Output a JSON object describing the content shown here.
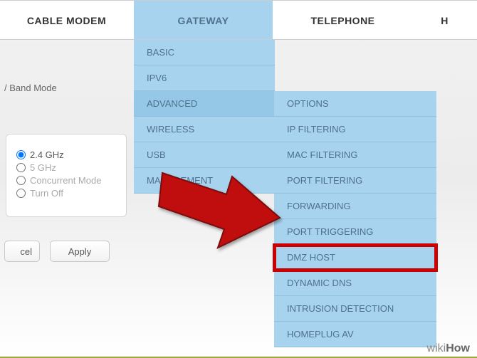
{
  "nav": {
    "tabs": [
      "CABLE MODEM",
      "GATEWAY",
      "TELEPHONE",
      "H"
    ],
    "active_index": 1
  },
  "breadcrumb": "/ Band Mode",
  "menu1": {
    "items": [
      "BASIC",
      "IPV6",
      "ADVANCED",
      "WIRELESS",
      "USB",
      "MANAGEMENT"
    ],
    "selected_index": 2
  },
  "menu2": {
    "items": [
      "OPTIONS",
      "IP FILTERING",
      "MAC FILTERING",
      "PORT FILTERING",
      "FORWARDING",
      "PORT TRIGGERING",
      "DMZ HOST",
      "DYNAMIC DNS",
      "INTRUSION DETECTION",
      "HOMEPLUG AV"
    ],
    "highlight_index": 6
  },
  "radios": {
    "options": [
      "2.4 GHz",
      "5 GHz",
      "Concurrent Mode",
      "Turn Off"
    ],
    "selected": 0
  },
  "buttons": {
    "cancel": "cel",
    "apply": "Apply"
  },
  "watermark": {
    "prefix": "wiki",
    "suffix": "How"
  }
}
